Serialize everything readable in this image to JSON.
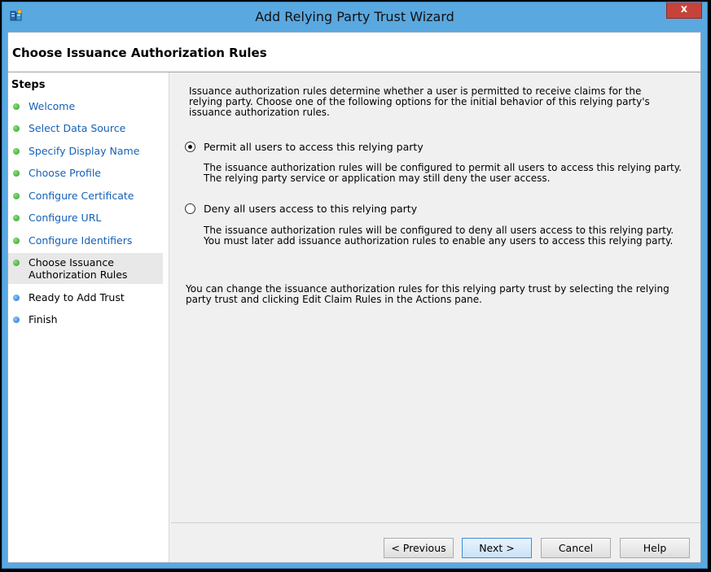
{
  "window": {
    "title": "Add Relying Party Trust Wizard",
    "close_glyph": "x"
  },
  "header": {
    "title": "Choose Issuance Authorization Rules"
  },
  "steps": {
    "heading": "Steps",
    "items": [
      {
        "label": "Welcome",
        "status": "done"
      },
      {
        "label": "Select Data Source",
        "status": "done"
      },
      {
        "label": "Specify Display Name",
        "status": "done"
      },
      {
        "label": "Choose Profile",
        "status": "done"
      },
      {
        "label": "Configure Certificate",
        "status": "done"
      },
      {
        "label": "Configure URL",
        "status": "done"
      },
      {
        "label": "Configure Identifiers",
        "status": "done"
      },
      {
        "label": "Choose Issuance Authorization Rules",
        "status": "current"
      },
      {
        "label": "Ready to Add Trust",
        "status": "pending"
      },
      {
        "label": "Finish",
        "status": "pending"
      }
    ]
  },
  "main": {
    "intro": "Issuance authorization rules determine whether a user is permitted to receive claims for the relying party. Choose one of the following options for the initial behavior of this relying party's issuance authorization rules.",
    "options": [
      {
        "label": "Permit all users to access this relying party",
        "checked": true,
        "description": "The issuance authorization rules will be configured to permit all users to access this relying party. The relying party service or application may still deny the user access."
      },
      {
        "label": "Deny all users access to this relying party",
        "checked": false,
        "description": "The issuance authorization rules will be configured to deny all users access to this relying party. You must later add issuance authorization rules to enable any users to access this relying party."
      }
    ],
    "note": "You can change the issuance authorization rules for this relying party trust by selecting the relying party trust and clicking Edit Claim Rules in the Actions pane."
  },
  "buttons": {
    "previous": "< Previous",
    "next": "Next >",
    "cancel": "Cancel",
    "help": "Help"
  },
  "colors": {
    "done_dot": "#2f9e24",
    "pending_dot": "#1f6fd0",
    "link": "#1560b8",
    "titlebar": "#5aa8e0",
    "close": "#c7433a"
  }
}
